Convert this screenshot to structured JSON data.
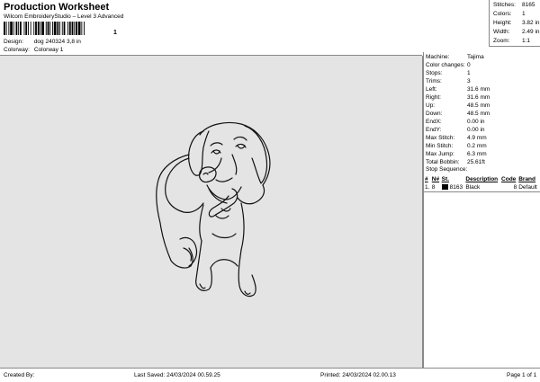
{
  "header": {
    "title": "Production Worksheet",
    "subtitle": "Wilcom EmbroideryStudio – Level 3 Advanced",
    "barcode_digit": "1",
    "design_label": "Design:",
    "design_value": "dog 240324 3,8 in",
    "colorway_label": "Colorway:",
    "colorway_value": "Colorway 1"
  },
  "stats": [
    {
      "label": "Stitches:",
      "value": "8165"
    },
    {
      "label": "Colors:",
      "value": "1"
    },
    {
      "label": "Height:",
      "value": "3.82 in"
    },
    {
      "label": "Width:",
      "value": "2.49 in"
    },
    {
      "label": "Zoom:",
      "value": "1:1"
    }
  ],
  "machine_info": [
    {
      "label": "Machine:",
      "value": "Tajima"
    },
    {
      "label": "Color changes:",
      "value": "0"
    },
    {
      "label": "Stops:",
      "value": "1"
    },
    {
      "label": "Trims:",
      "value": "3"
    },
    {
      "label": "Left:",
      "value": "31.6 mm"
    },
    {
      "label": "Right:",
      "value": "31.6 mm"
    },
    {
      "label": "Up:",
      "value": "48.5 mm"
    },
    {
      "label": "Down:",
      "value": "48.5 mm"
    },
    {
      "label": "EndX:",
      "value": "0.00 in"
    },
    {
      "label": "EndY:",
      "value": "0.00 in"
    },
    {
      "label": "Max Stitch:",
      "value": "4.9 mm"
    },
    {
      "label": "Min Stitch:",
      "value": "0.2 mm"
    },
    {
      "label": "Max Jump:",
      "value": "6.3 mm"
    },
    {
      "label": "Total Bobbin:",
      "value": "25.61ft"
    }
  ],
  "stop_sequence": {
    "title": "Stop Sequence:",
    "columns": [
      "#",
      "N#",
      "St.",
      "Description",
      "Code",
      "Brand"
    ],
    "rows": [
      {
        "num": "1.",
        "needle": "8",
        "stitches": "8163",
        "description": "Black",
        "code": "8",
        "brand": "Default",
        "color": "#000000"
      }
    ]
  },
  "footer": {
    "created": "Created By:",
    "last_saved": "Last Saved: 24/03/2024 00.59.25",
    "printed": "Printed: 24/03/2024 02.00.13",
    "page": "Page 1 of 1"
  }
}
